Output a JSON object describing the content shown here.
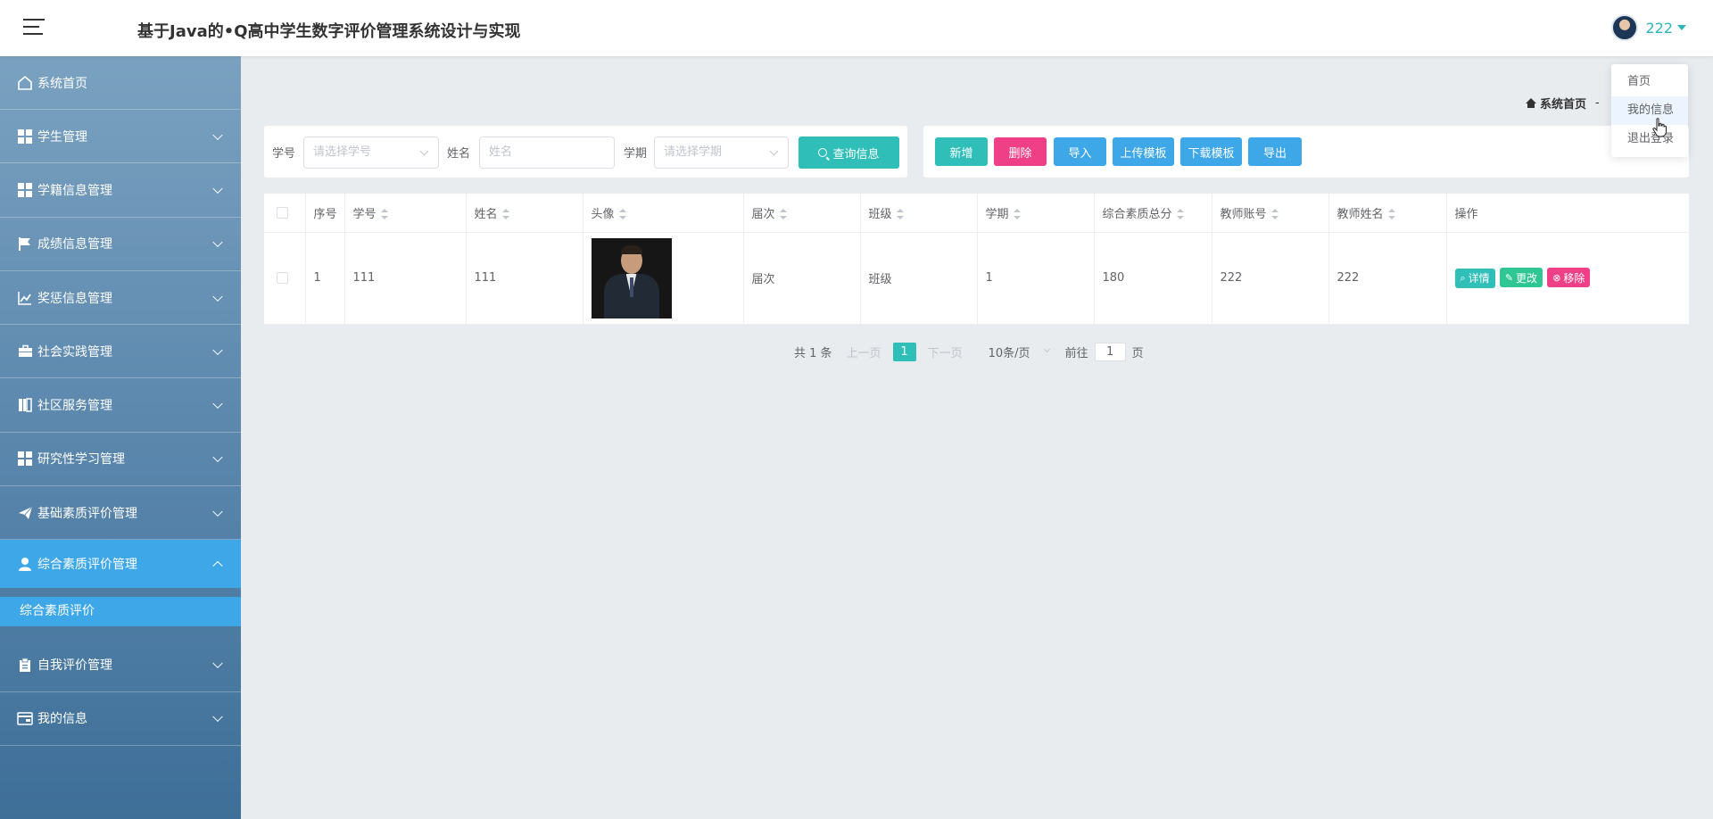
{
  "header": {
    "title": "基于Java的•Q高中学生数字评价管理系统设计与实现",
    "user_name": "222"
  },
  "sidebar": {
    "items": [
      {
        "label": "系统首页",
        "icon": "home-icon"
      },
      {
        "label": "学生管理",
        "icon": "grid-icon"
      },
      {
        "label": "学籍信息管理",
        "icon": "grid-icon"
      },
      {
        "label": "成绩信息管理",
        "icon": "flag-icon"
      },
      {
        "label": "奖惩信息管理",
        "icon": "chart-icon"
      },
      {
        "label": "社会实践管理",
        "icon": "briefcase-icon"
      },
      {
        "label": "社区服务管理",
        "icon": "book-icon"
      },
      {
        "label": "研究性学习管理",
        "icon": "grid-icon"
      },
      {
        "label": "基础素质评价管理",
        "icon": "send-icon"
      },
      {
        "label": "综合素质评价管理",
        "icon": "user-icon"
      },
      {
        "label": "自我评价管理",
        "icon": "clipboard-icon"
      },
      {
        "label": "我的信息",
        "icon": "wallet-icon"
      }
    ],
    "submenu_item": "综合素质评价"
  },
  "breadcrumb": {
    "home": "系统首页",
    "sep": "-"
  },
  "search": {
    "student_no_label": "学号",
    "student_no_placeholder": "请选择学号",
    "name_label": "姓名",
    "name_placeholder": "姓名",
    "term_label": "学期",
    "term_placeholder": "请选择学期",
    "query_label": "查询信息"
  },
  "actions": {
    "add": "新增",
    "delete": "删除",
    "import": "导入",
    "upload_template": "上传模板",
    "download_template": "下载模板",
    "export": "导出"
  },
  "table": {
    "headers": [
      "序号",
      "学号",
      "姓名",
      "头像",
      "届次",
      "班级",
      "学期",
      "综合素质总分",
      "教师账号",
      "教师姓名",
      "操作"
    ],
    "rows": [
      {
        "index": "1",
        "student_no": "111",
        "name": "111",
        "session": "届次",
        "class": "班级",
        "term": "1",
        "total_score": "180",
        "teacher_account": "222",
        "teacher_name": "222"
      }
    ],
    "op_detail": "详情",
    "op_edit": "更改",
    "op_remove": "移除"
  },
  "pager": {
    "total": "共 1 条",
    "prev": "上一页",
    "current": "1",
    "next": "下一页",
    "page_size": "10条/页",
    "goto": "前往",
    "goto_value": "1",
    "page_suffix": "页"
  },
  "dropdown": {
    "items": [
      "首页",
      "我的信息",
      "退出登录"
    ]
  },
  "colors": {
    "teal": "#2fbeb8",
    "pink": "#ef3f87",
    "blue": "#3ea7e8",
    "green": "#2ec793",
    "sidebar_active": "#3ea7e8"
  }
}
